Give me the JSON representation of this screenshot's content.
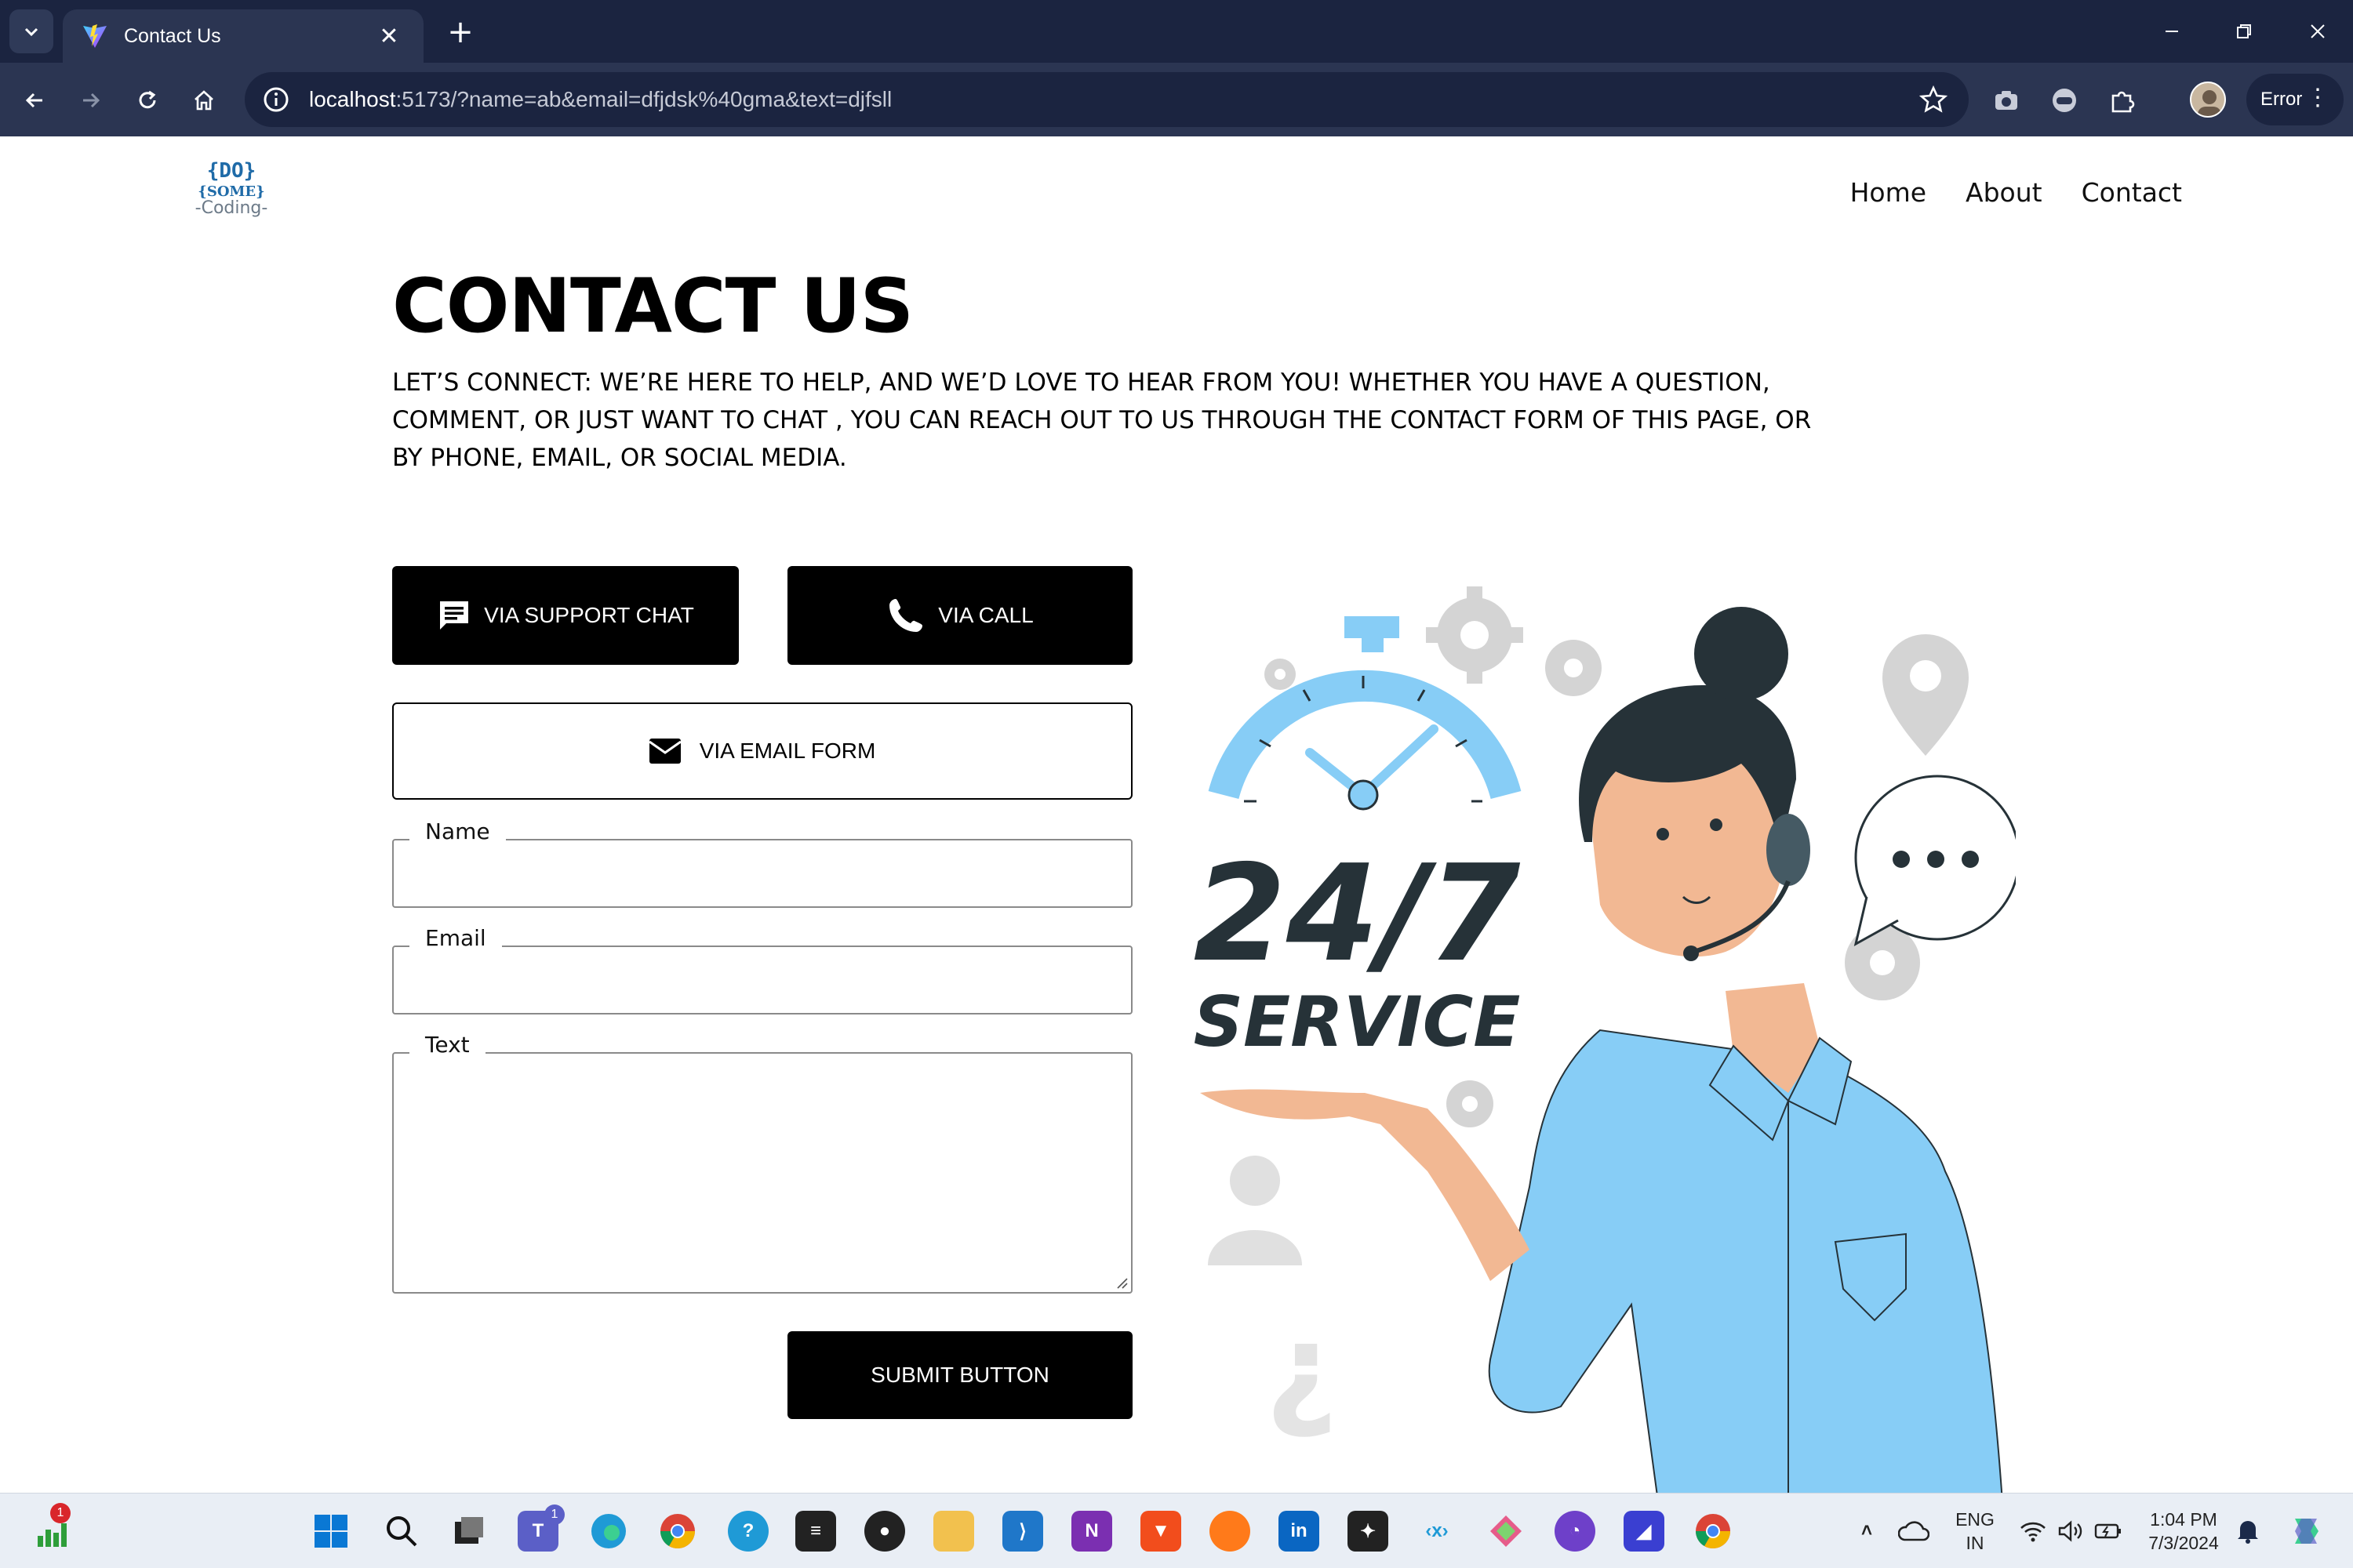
{
  "browser": {
    "tab_title": "Contact Us",
    "url_host": "localhost",
    "url_rest": ":5173/?name=ab&email=dfjdsk%40gma&text=djfsll",
    "profile_status": "Error"
  },
  "site": {
    "logo_text": [
      "{DO}",
      "{SOME}",
      "-Coding-"
    ],
    "nav": [
      "Home",
      "About",
      "Contact"
    ]
  },
  "contact": {
    "title": "CONTACT US",
    "subtitle": "LET’S CONNECT: WE’RE HERE TO HELP, AND WE’D LOVE TO HEAR FROM YOU! WHETHER YOU HAVE A QUESTION, COMMENT, OR JUST WANT TO CHAT , YOU CAN REACH OUT TO US THROUGH THE CONTACT FORM OF THIS PAGE, OR BY PHONE, EMAIL, OR SOCIAL MEDIA.",
    "buttons": {
      "support_chat": "VIA SUPPORT CHAT",
      "call": "VIA CALL",
      "email_form": "VIA EMAIL FORM",
      "submit": "SUBMIT BUTTON"
    },
    "fields": {
      "name_label": "Name",
      "email_label": "Email",
      "text_label": "Text",
      "name_value": "",
      "email_value": "",
      "text_value": ""
    }
  },
  "illustration": {
    "big_text": "24/7",
    "small_text": "SERVICE",
    "accent_color": "#87cdf6",
    "dark_color": "#263238"
  },
  "taskbar": {
    "chart_badge": "1",
    "teams_badge": "1",
    "lang_line1": "ENG",
    "lang_line2": "IN",
    "time": "1:04 PM",
    "date": "7/3/2024"
  },
  "colors": {
    "chrome_dark": "#1b2440",
    "chrome_mid": "#2b3552",
    "button_black": "#000000"
  }
}
